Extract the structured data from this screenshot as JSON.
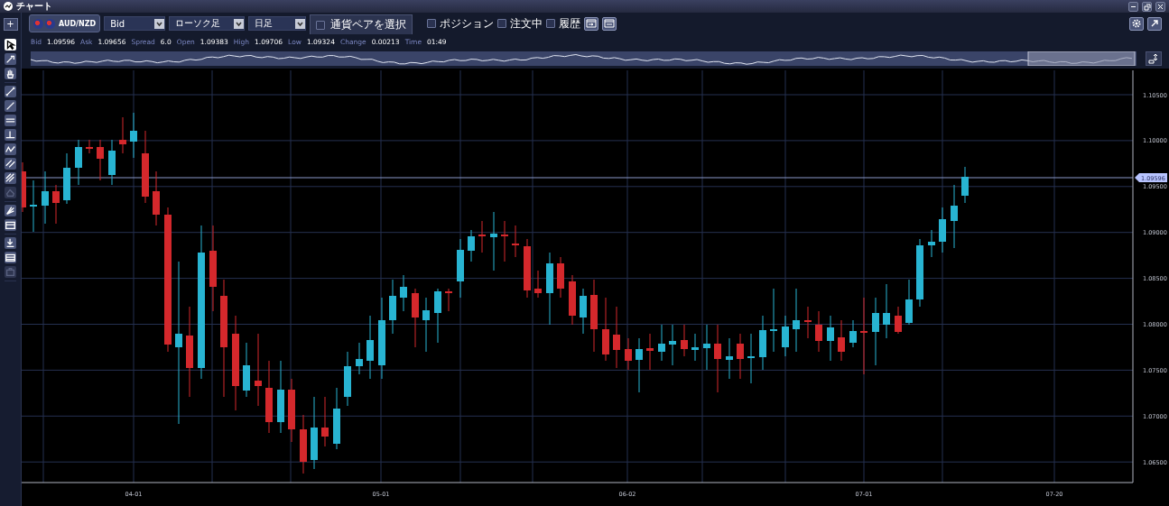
{
  "window": {
    "title": "チャート"
  },
  "toolbar": {
    "add_label": "+",
    "pair": "AUD/NZD",
    "dropdowns": [
      {
        "value": "Bid"
      },
      {
        "value": "ローソク足"
      },
      {
        "value": "日足"
      }
    ],
    "pair_select": {
      "label": "通貨ペアを選択",
      "checked": false
    },
    "checkboxes": [
      {
        "label": "ポジション",
        "checked": false
      },
      {
        "label": "注文中",
        "checked": false
      },
      {
        "label": "履歴",
        "checked": false
      }
    ]
  },
  "quote": [
    {
      "label": "Bid",
      "value": "1.09596"
    },
    {
      "label": "Ask",
      "value": "1.09656"
    },
    {
      "label": "Spread",
      "value": "6.0"
    },
    {
      "label": "Open",
      "value": "1.09383"
    },
    {
      "label": "High",
      "value": "1.09706"
    },
    {
      "label": "Low",
      "value": "1.09324"
    },
    {
      "label": "Change",
      "value": "0.00213"
    },
    {
      "label": "Time",
      "value": "01:49"
    }
  ],
  "tool_groups": [
    [
      {
        "selected": true,
        "disabled": false
      },
      {
        "selected": false,
        "disabled": false
      },
      {
        "selected": false,
        "disabled": false
      }
    ],
    [
      {
        "selected": false,
        "disabled": false
      },
      {
        "selected": false,
        "disabled": false
      },
      {
        "selected": false,
        "disabled": false
      },
      {
        "selected": false,
        "disabled": false
      },
      {
        "selected": false,
        "disabled": false
      },
      {
        "selected": false,
        "disabled": false
      },
      {
        "selected": false,
        "disabled": false
      },
      {
        "selected": false,
        "disabled": true
      }
    ],
    [
      {
        "selected": false,
        "disabled": false
      },
      {
        "selected": false,
        "disabled": false
      }
    ],
    [
      {
        "selected": false,
        "disabled": false
      },
      {
        "selected": false,
        "disabled": false
      },
      {
        "selected": false,
        "disabled": true
      }
    ]
  ],
  "chart": {
    "y_labels": [
      "1.10500",
      "1.10000",
      "1.09500",
      "1.09000",
      "1.08500",
      "1.08000",
      "1.07500",
      "1.07000",
      "1.06500"
    ],
    "x_labels": [
      "04-01",
      "05-01",
      "06-02",
      "07-01",
      "07-20"
    ],
    "price_tag": "1.09596"
  }
}
